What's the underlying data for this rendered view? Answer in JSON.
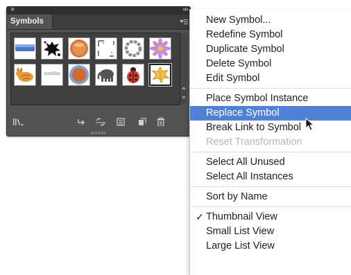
{
  "panel": {
    "tab_label": "Symbols",
    "close_glyph": "×",
    "collapse_glyph": "««",
    "symbols": [
      {
        "name": "blue-bar-symbol"
      },
      {
        "name": "ink-splat-symbol"
      },
      {
        "name": "orange-button-symbol"
      },
      {
        "name": "drawn-frame-symbol"
      },
      {
        "name": "chain-ring-symbol"
      },
      {
        "name": "purple-flower-symbol"
      },
      {
        "name": "cat-symbol"
      },
      {
        "name": "word-text-symbol",
        "text": "textitlist"
      },
      {
        "name": "orange-blue-button-symbol"
      },
      {
        "name": "elephant-symbol"
      },
      {
        "name": "ladybug-symbol"
      },
      {
        "name": "yellow-leaf-symbol"
      }
    ],
    "bottom_icons": [
      "library-menu-icon",
      "place-instance-icon",
      "break-link-icon",
      "symbol-options-icon",
      "new-symbol-icon",
      "delete-symbol-icon"
    ],
    "selected_index": 11
  },
  "menu": {
    "groups": [
      {
        "items": [
          {
            "label": "New Symbol...",
            "disabled": false
          },
          {
            "label": "Redefine Symbol",
            "disabled": false
          },
          {
            "label": "Duplicate Symbol",
            "disabled": false
          },
          {
            "label": "Delete Symbol",
            "disabled": false
          },
          {
            "label": "Edit Symbol",
            "disabled": false
          }
        ]
      },
      {
        "items": [
          {
            "label": "Place Symbol Instance",
            "disabled": false
          },
          {
            "label": "Replace Symbol",
            "disabled": false,
            "highlighted": true
          },
          {
            "label": "Break Link to Symbol",
            "disabled": false
          },
          {
            "label": "Reset Transformation",
            "disabled": true
          }
        ]
      },
      {
        "items": [
          {
            "label": "Select All Unused",
            "disabled": false
          },
          {
            "label": "Select All Instances",
            "disabled": false
          }
        ]
      },
      {
        "items": [
          {
            "label": "Sort by Name",
            "disabled": false
          }
        ]
      },
      {
        "items": [
          {
            "label": "Thumbnail View",
            "disabled": false,
            "checked": true
          },
          {
            "label": "Small List View",
            "disabled": false
          },
          {
            "label": "Large List View",
            "disabled": false
          }
        ]
      }
    ],
    "check_glyph": "✓"
  },
  "colors": {
    "panel_bg": "#535353",
    "highlight": "#4f82d6",
    "disabled_text": "#b6b6b6"
  }
}
